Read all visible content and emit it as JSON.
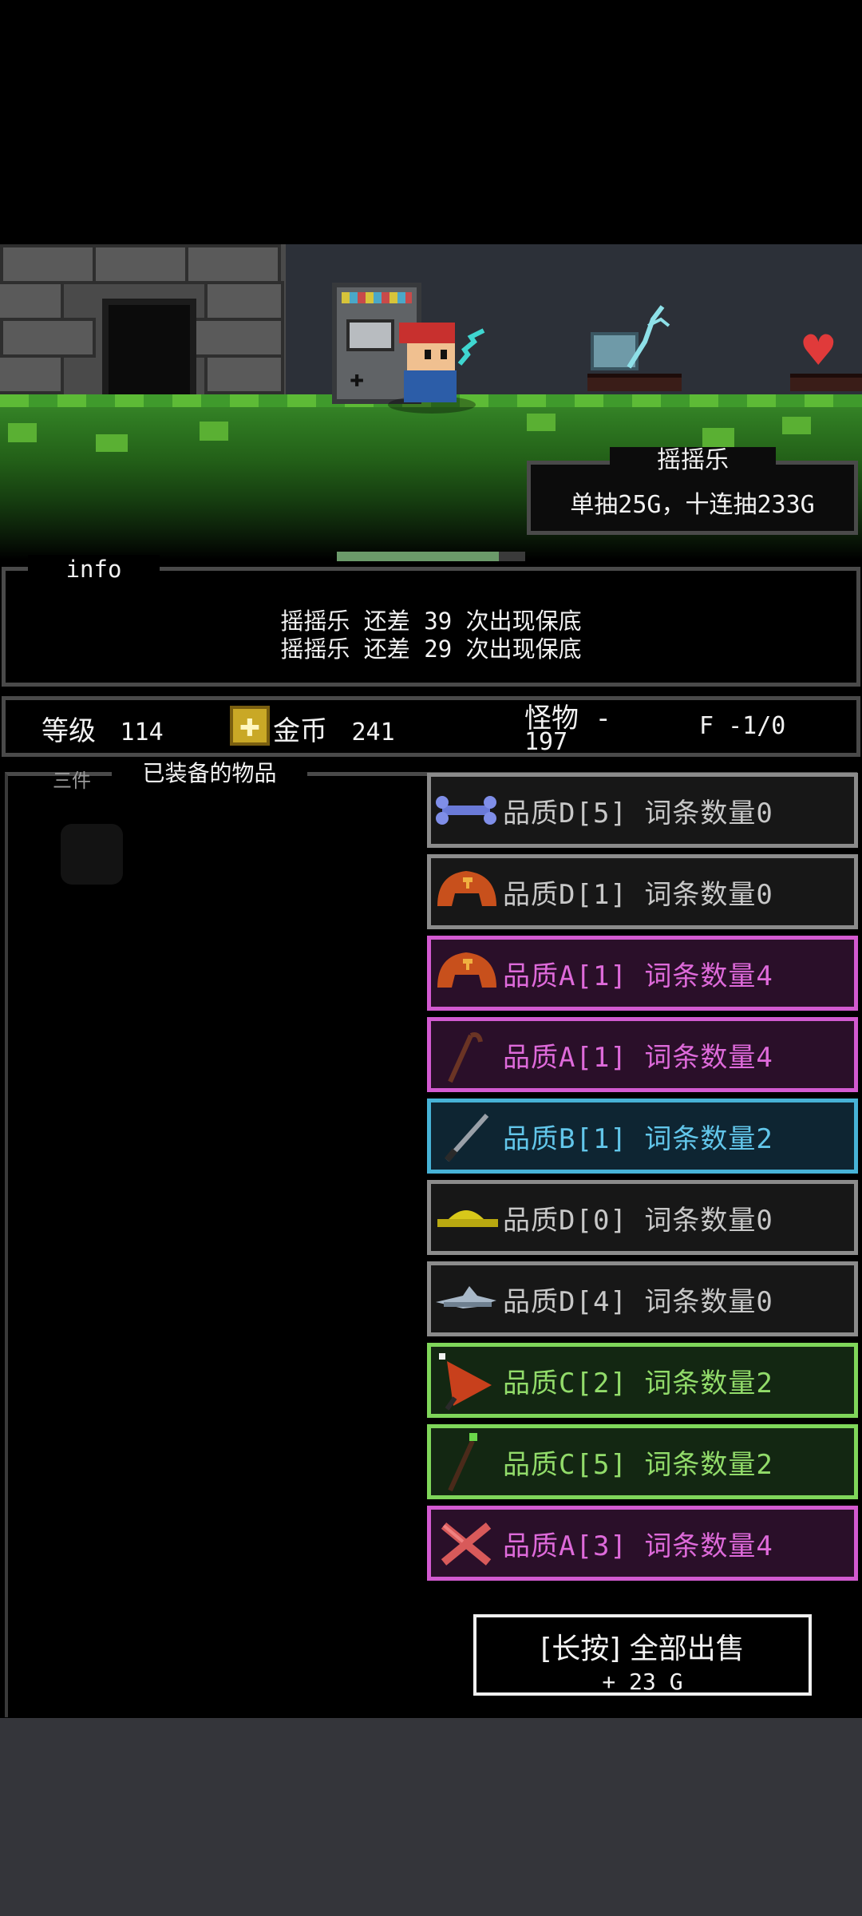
{
  "scene": {
    "gacha_title": "摇摇乐",
    "gacha_price": "单抽25G，十连抽233G",
    "progress": 0.86
  },
  "info": {
    "title": "info",
    "lines": [
      "摇摇乐 还差 39 次出现保底",
      "摇摇乐 还差 29 次出现保底"
    ]
  },
  "stats": {
    "level_label": "等级",
    "level_value": "114",
    "gold_label": "金币",
    "gold_value": "241",
    "monster_label": "怪物 -",
    "monster_value": "197",
    "floor": "F -1/0"
  },
  "equipment": {
    "hidden_tab": "三件",
    "title": "已装备的物品",
    "items": [
      {
        "text": "品质D[5] 词条数量0",
        "quality": "D",
        "icon": "bone-icon"
      },
      {
        "text": "品质D[1] 词条数量0",
        "quality": "D",
        "icon": "helmet-icon"
      },
      {
        "text": "品质A[1] 词条数量4",
        "quality": "A",
        "icon": "helmet-icon"
      },
      {
        "text": "品质A[1] 词条数量4",
        "quality": "A",
        "icon": "staff-icon"
      },
      {
        "text": "品质B[1] 词条数量2",
        "quality": "B",
        "icon": "sword-icon"
      },
      {
        "text": "品质D[0] 词条数量0",
        "quality": "D",
        "icon": "hat-icon"
      },
      {
        "text": "品质D[4] 词条数量0",
        "quality": "D",
        "icon": "fish-icon"
      },
      {
        "text": "品质C[2] 词条数量2",
        "quality": "C",
        "icon": "axe-icon"
      },
      {
        "text": "品质C[5] 词条数量2",
        "quality": "C",
        "icon": "wand-icon"
      },
      {
        "text": "品质A[3] 词条数量4",
        "quality": "A",
        "icon": "cross-bone-icon"
      }
    ]
  },
  "sell": {
    "label": "[长按] 全部出售",
    "amount": "+ 23 G"
  },
  "colors": {
    "quality_D": "#8b8b8b",
    "quality_A": "#d25ad0",
    "quality_B": "#47b2d6",
    "quality_C": "#7fd65a"
  }
}
